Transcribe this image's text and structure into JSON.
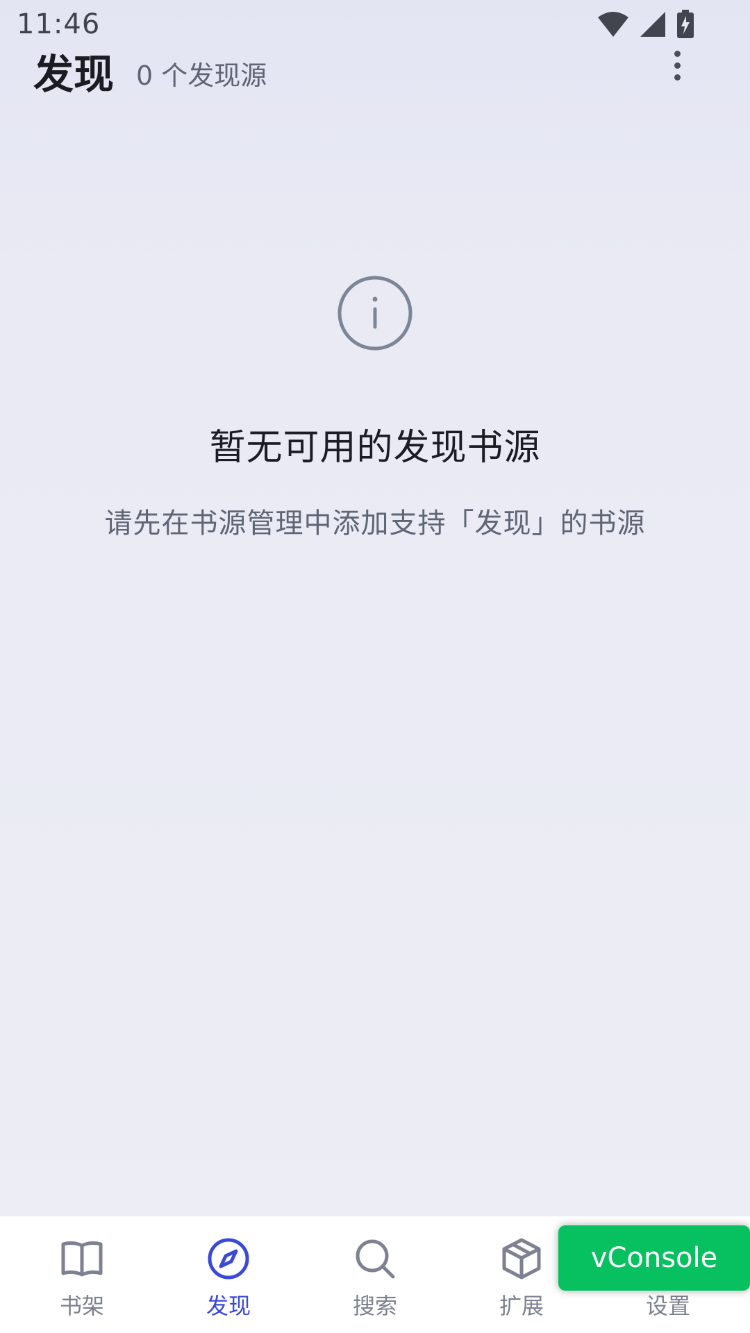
{
  "status_bar": {
    "time": "11:46"
  },
  "header": {
    "title": "发现",
    "source_count": "0 个发现源"
  },
  "empty_state": {
    "title": "暂无可用的发现书源",
    "description": "请先在书源管理中添加支持「发现」的书源"
  },
  "nav": {
    "items": [
      {
        "label": "书架",
        "icon": "book-icon"
      },
      {
        "label": "发现",
        "icon": "compass-icon",
        "active": true
      },
      {
        "label": "搜索",
        "icon": "search-icon"
      },
      {
        "label": "扩展",
        "icon": "package-icon"
      },
      {
        "label": "设置",
        "icon": "settings-icon"
      }
    ]
  },
  "vconsole": {
    "label": "vConsole"
  },
  "colors": {
    "accent": "#3a49d6",
    "inactive": "#7d8190",
    "vconsole_green": "#07c160"
  }
}
